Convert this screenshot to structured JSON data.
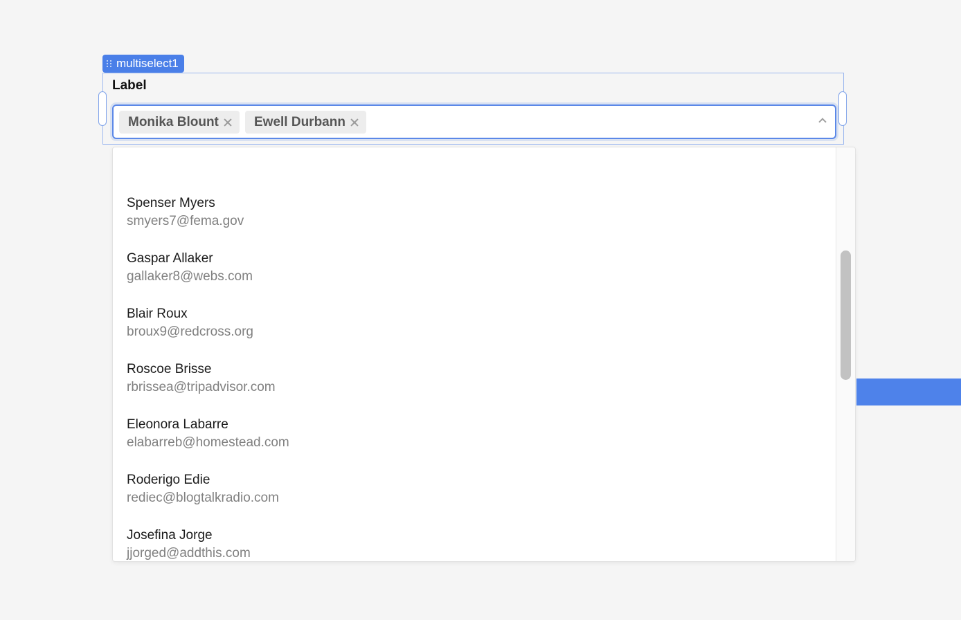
{
  "component": {
    "name": "multiselect1",
    "label": "Label"
  },
  "selected_tags": [
    {
      "label": "Monika Blount"
    },
    {
      "label": "Ewell Durbann"
    }
  ],
  "options": [
    {
      "name": "Spenser Myers",
      "email": "smyers7@fema.gov"
    },
    {
      "name": "Gaspar Allaker",
      "email": "gallaker8@webs.com"
    },
    {
      "name": "Blair Roux",
      "email": "broux9@redcross.org"
    },
    {
      "name": "Roscoe Brisse",
      "email": "rbrissea@tripadvisor.com"
    },
    {
      "name": "Eleonora Labarre",
      "email": "elabarreb@homestead.com"
    },
    {
      "name": "Roderigo Edie",
      "email": "rediec@blogtalkradio.com"
    },
    {
      "name": "Josefina Jorge",
      "email": "jjorged@addthis.com"
    }
  ],
  "colors": {
    "accent": "#4a7fe8",
    "tag_bg": "#ededed",
    "page_bg": "#f5f5f5"
  },
  "icons": {
    "tag_remove": "close-icon",
    "dropdown_toggle": "chevron-up-icon",
    "drag_handle": "drag-handle-icon"
  }
}
